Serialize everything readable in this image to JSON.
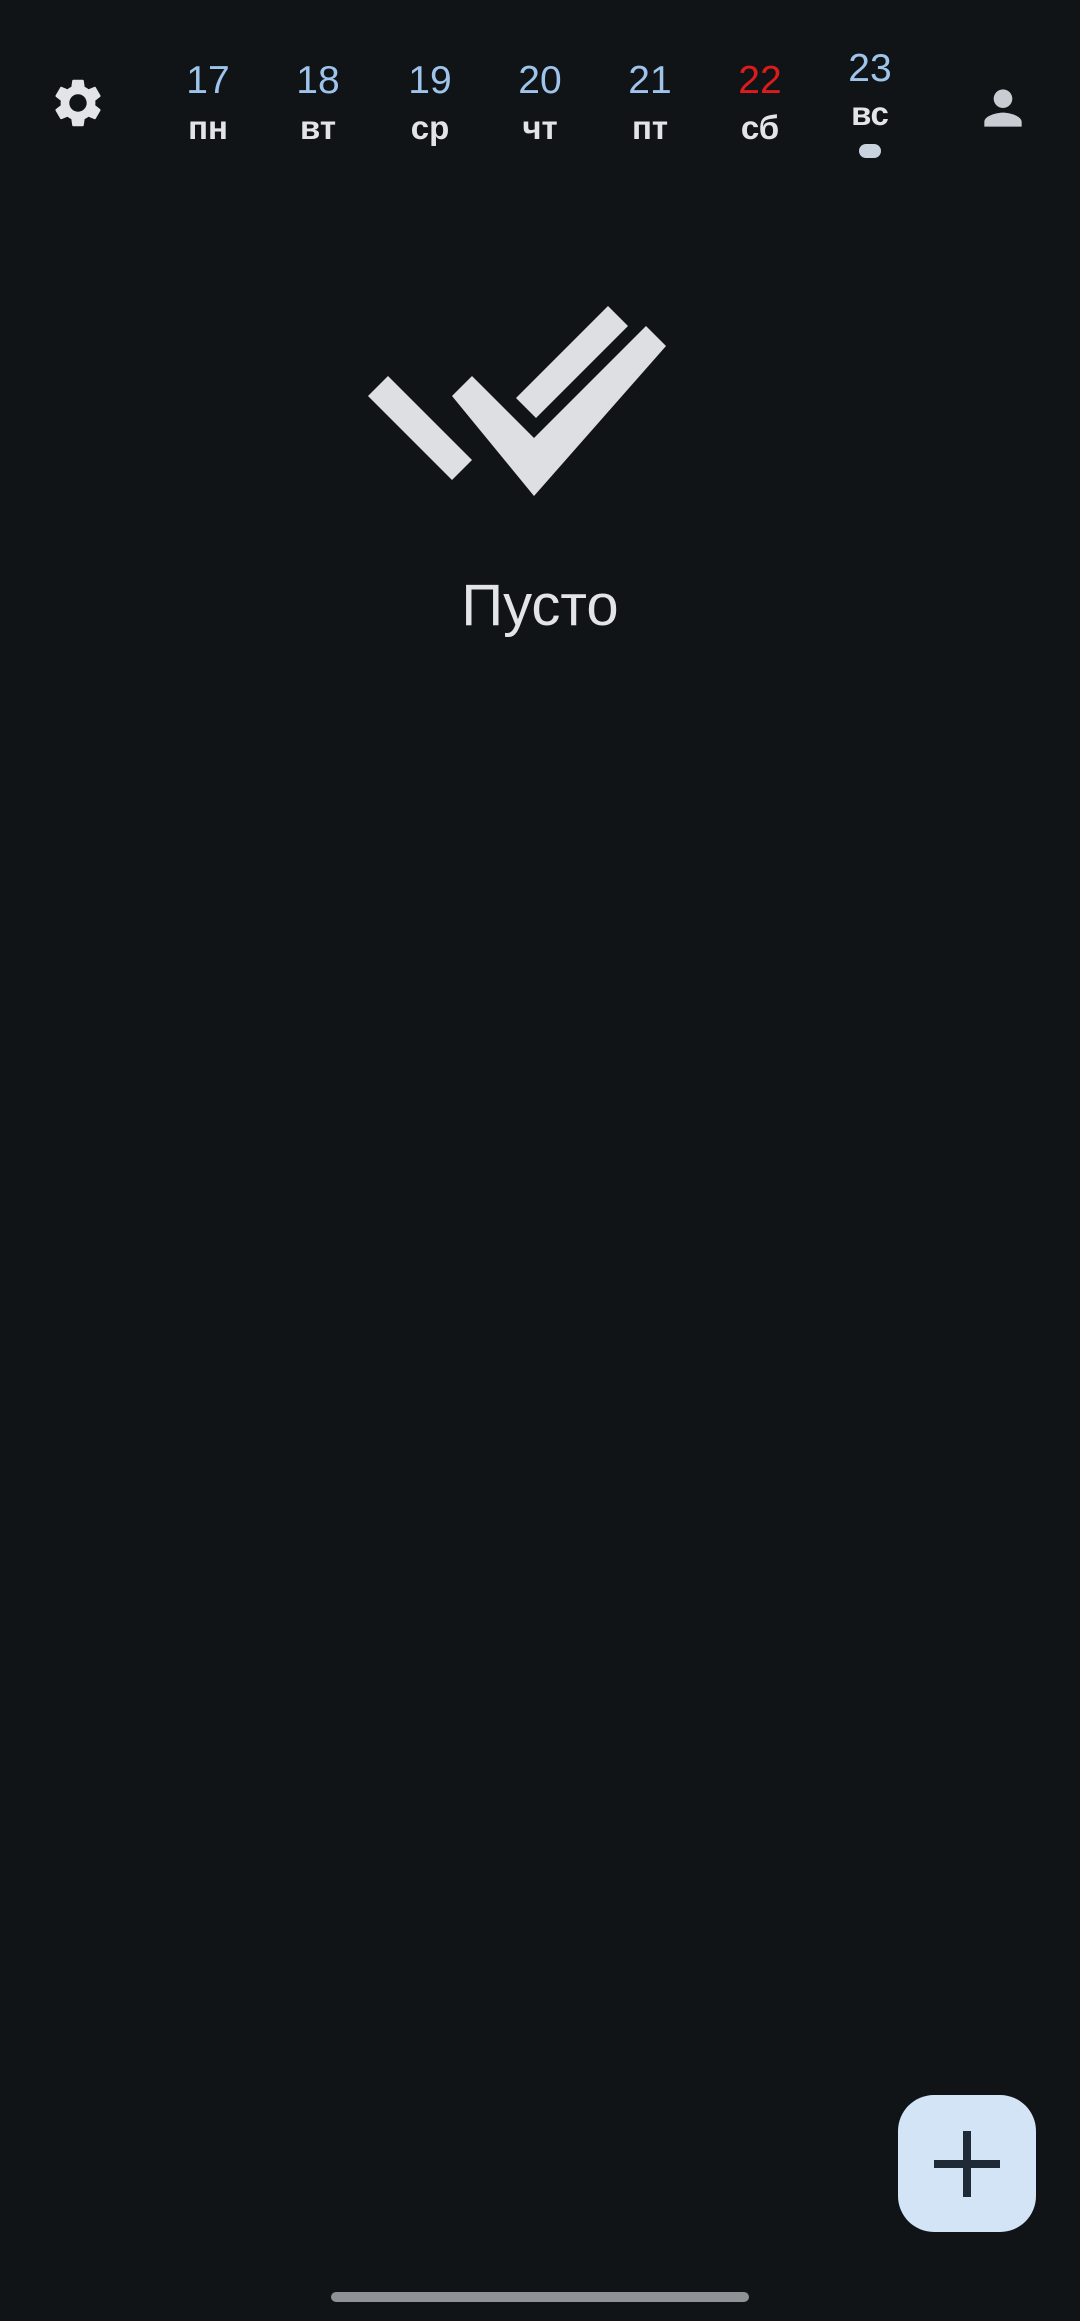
{
  "toolbar": {
    "settings_icon": "gear-icon",
    "profile_icon": "person-icon"
  },
  "days": [
    {
      "num": "17",
      "weekday": "пн",
      "weekend": false,
      "selected": false
    },
    {
      "num": "18",
      "weekday": "вт",
      "weekend": false,
      "selected": false
    },
    {
      "num": "19",
      "weekday": "ср",
      "weekend": false,
      "selected": false
    },
    {
      "num": "20",
      "weekday": "чт",
      "weekend": false,
      "selected": false
    },
    {
      "num": "21",
      "weekday": "пт",
      "weekend": false,
      "selected": false
    },
    {
      "num": "22",
      "weekday": "сб",
      "weekend": true,
      "selected": false
    },
    {
      "num": "23",
      "weekday": "вс",
      "weekend": false,
      "selected": true
    }
  ],
  "empty_state": {
    "icon": "double-check-icon",
    "label": "Пусто"
  },
  "fab": {
    "icon": "plus-icon"
  },
  "colors": {
    "background": "#111417",
    "day_number": "#9ec4ec",
    "weekend_number": "#dc1c1c",
    "text": "#e2e4e8",
    "fab_background": "#d2e4f6",
    "fab_icon": "#1e2a36"
  }
}
